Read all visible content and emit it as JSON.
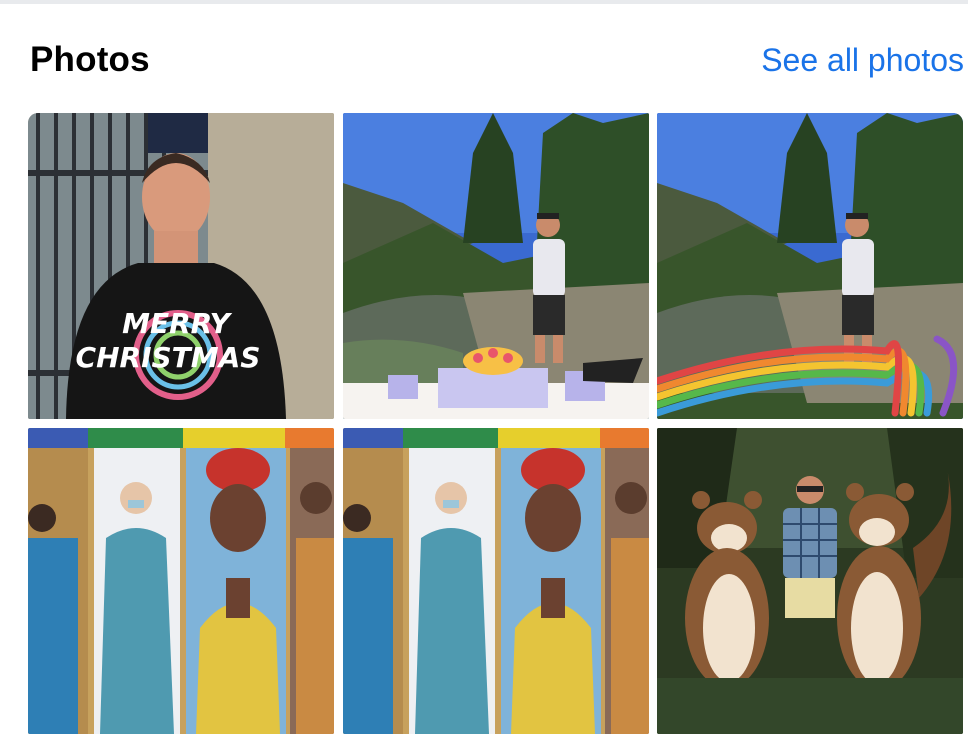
{
  "section": {
    "title": "Photos",
    "see_all_label": "See all photos"
  },
  "photos": [
    {
      "subject": "man in black t-shirt",
      "shirt_text_line1": "MERRY",
      "shirt_text_line2": "CHRISTMAS"
    },
    {
      "subject": "hiker by river with gift doodle"
    },
    {
      "subject": "hiker by river with rainbow ribbon doodle"
    },
    {
      "subject": "people in colorful collage"
    },
    {
      "subject": "people in colorful collage"
    },
    {
      "subject": "man with two chipmunk characters"
    }
  ],
  "colors": {
    "link": "#1a73e8",
    "title": "#000000"
  }
}
